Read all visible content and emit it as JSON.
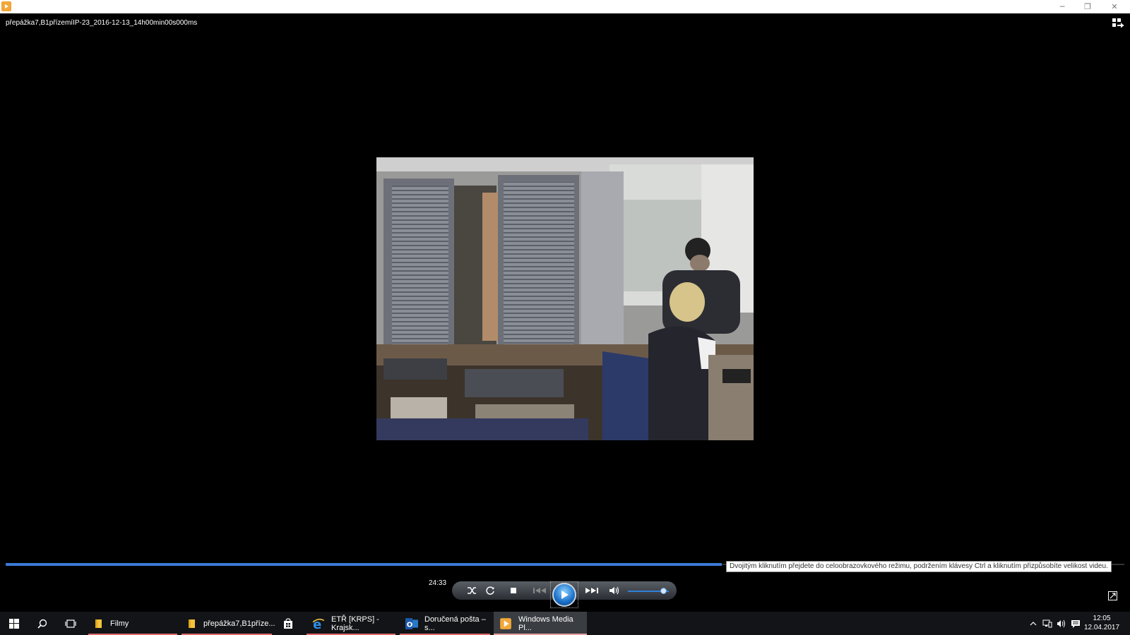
{
  "window": {
    "title": "přepážka7,B1přízemíIP-23_2016-12-13_14h00min00s000ms",
    "minimize_glyph": "─",
    "restore_glyph": "❐",
    "close_glyph": "✕"
  },
  "player": {
    "video_alt": "security camera footage of post office counter",
    "tooltip": "Dvojitým kliknutím přejdete do celoobrazovkového režimu, podržením klávesy Ctrl a kliknutím přizpůsobíte velikost videu.",
    "elapsed": "24:33",
    "seek_progress_percent": 64,
    "volume_percent": 88,
    "controls": {
      "shuffle": "shuffle-icon",
      "repeat": "repeat-icon",
      "stop": "stop-icon",
      "previous": "previous-icon",
      "play": "play-icon",
      "next": "next-icon",
      "mute": "volume-icon"
    }
  },
  "taskbar": {
    "buttons": [
      {
        "label": "Filmy",
        "icon": "folder-icon"
      },
      {
        "label": "přepážka7,B1příze...",
        "icon": "folder-icon"
      },
      {
        "label": "ETŘ [KRPS] - Krajsk...",
        "icon": "internet-explorer-icon"
      },
      {
        "label": "Doručená pošta – s...",
        "icon": "outlook-icon"
      },
      {
        "label": "Windows Media Pl...",
        "icon": "windows-media-player-icon"
      }
    ],
    "clock": {
      "time": "12:05",
      "date": "12.04.2017"
    }
  }
}
